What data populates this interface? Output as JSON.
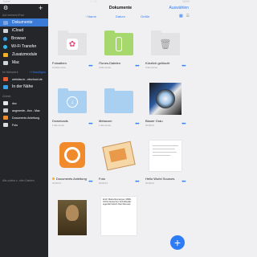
{
  "status": {
    "left": "Safari",
    "time": "17:55",
    "right": "100%"
  },
  "sidebar": {
    "storage_header": "Auf meinem iPad",
    "items": [
      {
        "label": "Dokumente",
        "color": "#3b7bd8",
        "active": true
      },
      {
        "label": "iCloud",
        "color": "#cfd5dd"
      },
      {
        "label": "Browser",
        "color": "#3aa0e8"
      },
      {
        "label": "Wi-Fi Transfer",
        "color": "#36b7e8"
      },
      {
        "label": "Zusatzmodule",
        "color": "#f3b12a"
      },
      {
        "label": "Mac",
        "color": "#cfd5dd"
      }
    ],
    "network_header": "Im Netzwerk",
    "network_add": "+ Hinzufügen",
    "network_items": [
      {
        "label": "webdav.m...rdschool.de",
        "color": "#e95b33"
      },
      {
        "label": "In der Nähe",
        "color": "#3aa0e8"
      }
    ],
    "recent_header": "Zuletzt",
    "recent_items": [
      {
        "label": "doc",
        "color": "#e7e7e7"
      },
      {
        "label": "augmente...tion - Mac",
        "color": "#cccccc"
      },
      {
        "label": "Documents Anleitung",
        "color": "#f18a2a"
      },
      {
        "label": "Foto",
        "color": "#dddddd"
      }
    ],
    "footer": "Alle zuletzt v...eten Dateien"
  },
  "main": {
    "title": "Dokumente",
    "select": "Auswählen",
    "sort": {
      "name": "Name",
      "date": "Datum",
      "size": "Größe"
    },
    "tiles": [
      {
        "name": "Fotoalben",
        "meta": "10 Elemente"
      },
      {
        "name": "iTunes-Dateien",
        "meta": "0 Elemente"
      },
      {
        "name": "Kürzlich gelöscht",
        "meta": "0 Elemente"
      },
      {
        "name": "Downloads",
        "meta": "1 Elemente"
      },
      {
        "name": "Metacom",
        "meta": "1 Elemente"
      },
      {
        "name": "Blauer Grau",
        "meta": "2018-01"
      },
      {
        "name": "Documents Anleitung",
        "meta": "2018-01"
      },
      {
        "name": "Foto",
        "meta": "2018-01"
      },
      {
        "name": "Hello World Sources",
        "meta": "2018-01"
      },
      {
        "name": "",
        "meta": ""
      },
      {
        "name": "",
        "meta": ""
      },
      {
        "name": "",
        "meta": ""
      }
    ],
    "doc_text": "Erich Maria Remarque (1898-1970) Deutscher Schriftsteller eigentlich Erich Paul Remark",
    "fab": "+"
  }
}
